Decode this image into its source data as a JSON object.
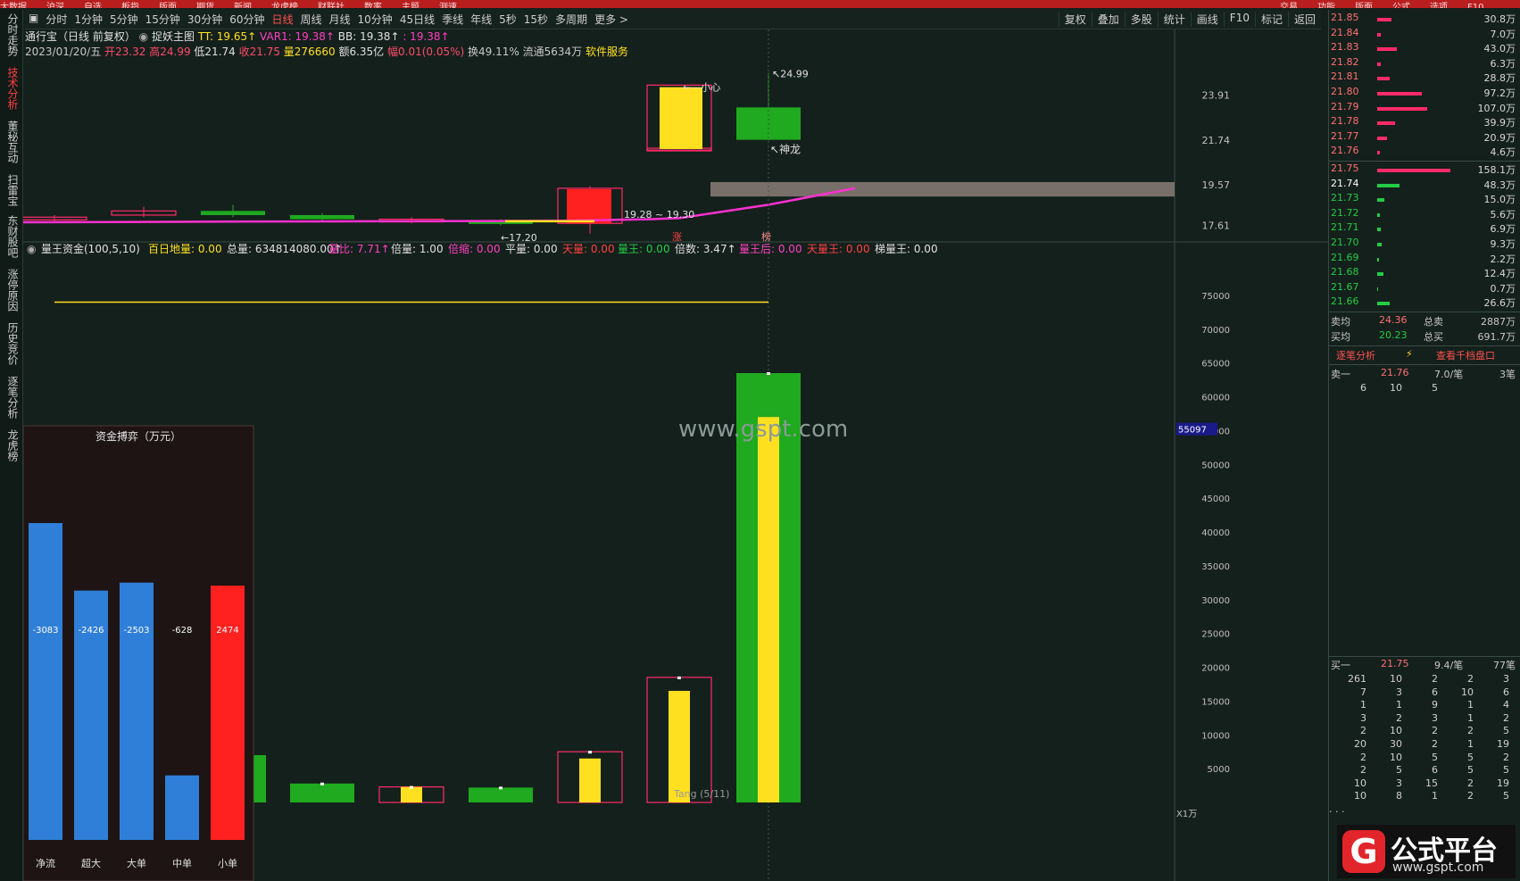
{
  "top_menu": [
    "大数据",
    "沪深",
    "自选",
    "板指",
    "版面",
    "期货",
    "新闻",
    "龙虎榜",
    "财联社",
    "数率",
    "主题",
    "测速",
    "交易",
    "功能",
    "版面",
    "公式",
    "选项",
    "F10"
  ],
  "toolbar": {
    "periods": [
      "分时",
      "1分钟",
      "5分钟",
      "15分钟",
      "30分钟",
      "60分钟",
      "日线",
      "周线",
      "月线",
      "10分钟",
      "45日线",
      "季线",
      "年线",
      "5秒",
      "15秒",
      "多周期",
      "更多 >"
    ],
    "active_period": "日线",
    "right_tools": [
      "复权",
      "叠加",
      "多股",
      "统计",
      "画线",
      "F10",
      "标记",
      "返回"
    ]
  },
  "side_tabs": [
    "分时走势",
    "技术分析",
    "董秘互动",
    "扫雷宝",
    "东财股吧",
    "涨停原因",
    "历史竞价",
    "逐笔分析",
    "龙虎榜"
  ],
  "side_tabs_active": "技术分析",
  "header": {
    "title": "通行宝（日线 前复权）",
    "formula": "捉妖主图",
    "TT": "TT: 19.65↑",
    "VAR1": "VAR1: 19.38↑",
    "BB": "BB: 19.38↑",
    "extra": ": 19.38↑",
    "date": "2023/01/20/五",
    "open": "开23.32",
    "high": "高24.99",
    "low": "低21.74",
    "close": "收21.75",
    "volume": "量276660",
    "amount": "额6.35亿",
    "change": "幅0.01(0.05%)",
    "turnover": "换49.11%",
    "float": "流通5634万",
    "industry": "软件服务"
  },
  "price_axis": [
    "23.91",
    "21.74",
    "19.57",
    "17.61"
  ],
  "price_annotations": {
    "high_label": "↖24.99",
    "low_label": "←17.20",
    "range_label": "19.28 ~ 19.30",
    "caution": "←—小心",
    "dragon": "↖神龙",
    "zhang": "涨",
    "bang": "榜"
  },
  "indicator_header": {
    "name": "量王资金(100,5,10)",
    "items": [
      "百日地量: 0.00",
      "总量: 634814080.00↑",
      "量比: 7.71↑",
      "倍量: 1.00",
      "倍缩: 0.00",
      "平量: 0.00",
      "天量: 0.00",
      "量王: 0.00",
      "倍数: 3.47↑",
      "量王后: 0.00",
      "天量王: 0.00",
      "梯量王: 0.00"
    ]
  },
  "volume_axis": [
    "75000",
    "70000",
    "65000",
    "60000",
    "55000",
    "50000",
    "45000",
    "40000",
    "35000",
    "30000",
    "25000",
    "20000",
    "15000",
    "10000",
    "5000"
  ],
  "volume_cursor": "55097",
  "volume_unit": "X1万",
  "volume_label": "Tang (5/11)",
  "watermark": "www.gspt.com",
  "capital_panel": {
    "title": "资金搏弈（万元）",
    "bars": [
      {
        "label": "净流",
        "value": -3083,
        "text": "-3083",
        "color": "#2f7fd8"
      },
      {
        "label": "超大",
        "value": -2426,
        "text": "-2426",
        "color": "#2f7fd8"
      },
      {
        "label": "大单",
        "value": -2503,
        "text": "-2503",
        "color": "#2f7fd8"
      },
      {
        "label": "中单",
        "value": -628,
        "text": "-628",
        "color": "#2f7fd8"
      },
      {
        "label": "小单",
        "value": 2474,
        "text": "2474",
        "color": "#ff2020"
      }
    ]
  },
  "chart_data": {
    "type": "candlestick-volume",
    "candles": [
      {
        "open": 18.0,
        "close": 17.9,
        "high": 18.1,
        "low": 17.8,
        "color": "#ff2a6a",
        "hollow": true
      },
      {
        "open": 18.1,
        "close": 18.3,
        "high": 18.5,
        "low": 18.0,
        "color": "#ff2a6a",
        "hollow": true
      },
      {
        "open": 18.3,
        "close": 18.1,
        "high": 18.6,
        "low": 18.0,
        "color": "#1faa1f",
        "hollow": false
      },
      {
        "open": 18.1,
        "close": 17.9,
        "high": 18.2,
        "low": 17.8,
        "color": "#1faa1f",
        "hollow": false
      },
      {
        "open": 17.8,
        "close": 17.9,
        "high": 18.0,
        "low": 17.7,
        "color": "#ff2a6a",
        "hollow": true
      },
      {
        "open": 17.8,
        "close": 17.7,
        "high": 17.9,
        "low": 17.6,
        "color": "#1faa1f",
        "hollow": false
      },
      {
        "open": 17.7,
        "close": 19.4,
        "high": 19.5,
        "low": 17.2,
        "color": "#ff2a6a",
        "hollow": true
      },
      {
        "open": 21.3,
        "close": 21.34,
        "high": 21.35,
        "low": 21.3,
        "color": "#ff2a6a",
        "hollow": true
      },
      {
        "open": 23.32,
        "close": 21.75,
        "high": 24.99,
        "low": 21.74,
        "color": "#1faa1f",
        "hollow": false
      }
    ],
    "volumes": [
      {
        "value": 3500,
        "inner": 3500,
        "color": "#1faa1f",
        "hollow": false
      },
      {
        "value": 2800,
        "inner": 2800,
        "color": "#1faa1f",
        "hollow": false
      },
      {
        "value": 2300,
        "inner": 2300,
        "color": "#ff2a6a",
        "hollow": true
      },
      {
        "value": 2200,
        "inner": 2200,
        "color": "#1faa1f",
        "hollow": false
      },
      {
        "value": 7500,
        "inner": 6500,
        "color": "#ff2a6a",
        "hollow": true
      },
      {
        "value": 18500,
        "inner": 16500,
        "color": "#ff2a6a",
        "hollow": true
      },
      {
        "value": 63500,
        "inner": 57000,
        "color": "#1faa1f",
        "hollow": false
      }
    ],
    "price_range": [
      16.8,
      25.8
    ],
    "volume_range": [
      0,
      80000
    ],
    "yellow_line_level": 74000,
    "band_range": [
      19.0,
      19.7
    ]
  },
  "order_book": {
    "asks": [
      {
        "price": "21.85",
        "vol": "30.8万",
        "bar": 16
      },
      {
        "price": "21.84",
        "vol": "7.0万",
        "bar": 4
      },
      {
        "price": "21.83",
        "vol": "43.0万",
        "bar": 22
      },
      {
        "price": "21.82",
        "vol": "6.3万",
        "bar": 4
      },
      {
        "price": "21.81",
        "vol": "28.8万",
        "bar": 14
      },
      {
        "price": "21.80",
        "vol": "97.2万",
        "bar": 50
      },
      {
        "price": "21.79",
        "vol": "107.0万",
        "bar": 56
      },
      {
        "price": "21.78",
        "vol": "39.9万",
        "bar": 20
      },
      {
        "price": "21.77",
        "vol": "20.9万",
        "bar": 11
      },
      {
        "price": "21.76",
        "vol": "4.6万",
        "bar": 3
      }
    ],
    "bids": [
      {
        "price": "21.75",
        "vol": "158.1万",
        "bar": 82,
        "color": "#ff2a6a"
      },
      {
        "price": "21.74",
        "vol": "48.3万",
        "bar": 25,
        "color": "#22cc44"
      },
      {
        "price": "21.73",
        "vol": "15.0万",
        "bar": 8,
        "color": "#22cc44"
      },
      {
        "price": "21.72",
        "vol": "5.6万",
        "bar": 3,
        "color": "#22cc44"
      },
      {
        "price": "21.71",
        "vol": "6.9万",
        "bar": 4,
        "color": "#22cc44"
      },
      {
        "price": "21.70",
        "vol": "9.3万",
        "bar": 5,
        "color": "#22cc44"
      },
      {
        "price": "21.69",
        "vol": "2.2万",
        "bar": 2,
        "color": "#22cc44"
      },
      {
        "price": "21.68",
        "vol": "12.4万",
        "bar": 7,
        "color": "#22cc44"
      },
      {
        "price": "21.67",
        "vol": "0.7万",
        "bar": 1,
        "color": "#22cc44"
      },
      {
        "price": "21.66",
        "vol": "26.6万",
        "bar": 14,
        "color": "#22cc44"
      }
    ],
    "sell_avg_label": "卖均",
    "sell_avg": "24.36",
    "total_sell_label": "总卖",
    "total_sell": "2887万",
    "buy_avg_label": "买均",
    "buy_avg": "20.23",
    "total_buy_label": "总买",
    "total_buy": "691.7万",
    "tick_analysis": "逐笔分析",
    "view_book": "查看千档盘口",
    "sell1_label": "卖一",
    "sell1_price": "21.76",
    "sell1_per": "7.0/笔",
    "sell1_count": "3笔",
    "sell1_queue": [
      "6",
      "10",
      "5"
    ],
    "buy1_label": "买一",
    "buy1_price": "21.75",
    "buy1_per": "9.4/笔",
    "buy1_count": "77笔",
    "buy1_queue": [
      [
        "261",
        "10",
        "2",
        "2",
        "3"
      ],
      [
        "7",
        "3",
        "6",
        "10",
        "6"
      ],
      [
        "1",
        "1",
        "9",
        "1",
        "4"
      ],
      [
        "3",
        "2",
        "3",
        "1",
        "2"
      ],
      [
        "2",
        "10",
        "2",
        "2",
        "5"
      ],
      [
        "20",
        "30",
        "2",
        "1",
        "19"
      ],
      [
        "2",
        "10",
        "5",
        "5",
        "2"
      ],
      [
        "2",
        "5",
        "6",
        "5",
        "5"
      ],
      [
        "10",
        "3",
        "15",
        "2",
        "19"
      ],
      [
        "10",
        "8",
        "1",
        "2",
        "5"
      ]
    ],
    "more": ". . ."
  },
  "logo": {
    "brand": "公式平台",
    "url": "www.gspt.com"
  },
  "colors": {
    "up": "#ff2a6a",
    "down": "#1faa1f",
    "yellow": "#ffe020",
    "magenta": "#ff30d0",
    "band": "#8a7e78",
    "blue": "#2f7fd8"
  }
}
